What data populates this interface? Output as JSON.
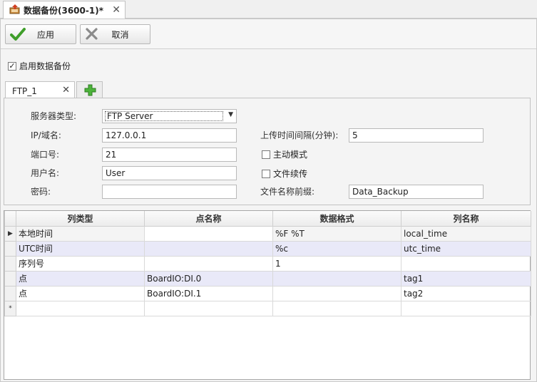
{
  "doc_tab": {
    "title": "数据备份(3600-1)*",
    "close": "✕"
  },
  "toolbar": {
    "apply_label": "应用",
    "cancel_label": "取消"
  },
  "enable": {
    "label": "启用数据备份",
    "checked": true,
    "mark": "✓"
  },
  "inner_tabs": {
    "ftp_label": "FTP_1",
    "close": "✕",
    "add": "+"
  },
  "form": {
    "server_type_label": "服务器类型:",
    "server_type_value": "FTP Server",
    "ip_label": "IP/域名:",
    "ip_value": "127.0.0.1",
    "port_label": "端口号:",
    "port_value": "21",
    "user_label": "用户名:",
    "user_value": "User",
    "password_label": "密码:",
    "password_value": "",
    "interval_label": "上传时间间隔(分钟):",
    "interval_value": "5",
    "active_mode_label": "主动模式",
    "active_mode_checked": false,
    "resume_label": "文件续传",
    "resume_checked": false,
    "prefix_label": "文件名称前缀:",
    "prefix_value": "Data_Backup"
  },
  "grid": {
    "headers": [
      "列类型",
      "点名称",
      "数据格式",
      "列名称"
    ],
    "rows": [
      [
        "本地时间",
        "",
        "%F %T",
        "local_time"
      ],
      [
        "UTC时间",
        "",
        "%c",
        "utc_time"
      ],
      [
        "序列号",
        "",
        "1",
        ""
      ],
      [
        "点",
        "BoardIO:DI.0",
        "",
        "tag1"
      ],
      [
        "点",
        "BoardIO:DI.1",
        "",
        "tag2"
      ]
    ],
    "current_marker": "▶",
    "new_row_marker": "*"
  }
}
